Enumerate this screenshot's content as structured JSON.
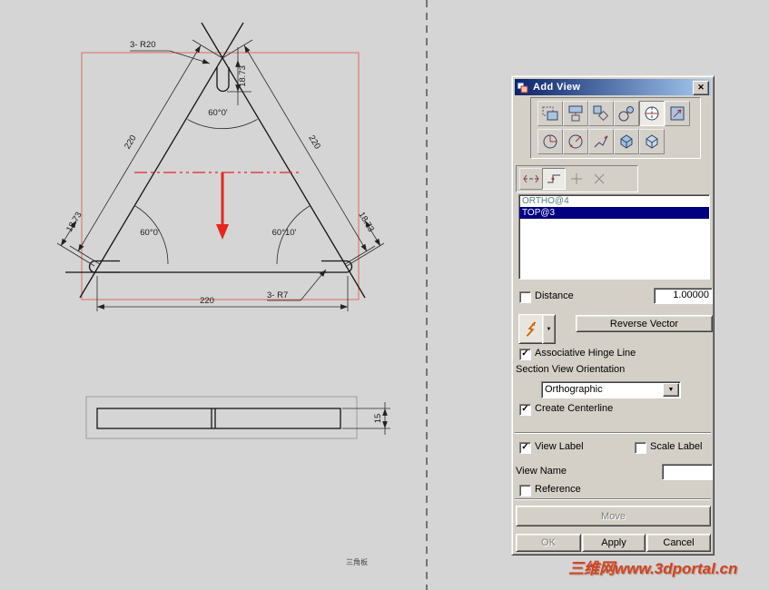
{
  "colors": {
    "selection_navy": "#000080",
    "section_arrow_red": "#e8251d",
    "view_boundary_red": "#dd6a5a",
    "watermark_orange": "#cd4621"
  },
  "icons": {
    "close": "✕",
    "dropdown": "▼",
    "check": "✓"
  },
  "drawing": {
    "radius_note_top": "3- R20",
    "slot_depth": "18.73",
    "angle_top": "60°0'",
    "side_left": "220",
    "side_right": "220",
    "notch_left": "18.73",
    "angle_bottom_left": "60°0'",
    "angle_bottom_right": "60°10'",
    "notch_right": "18.73",
    "side_bottom": "220",
    "radius_note_bottom": "3- R7",
    "thickness": "15",
    "title_block": "三角板"
  },
  "watermark": "三维网www.3dportal.cn",
  "dialog": {
    "title": "Add View",
    "view_list": [
      {
        "label": "ORTHO@4"
      },
      {
        "label": "TOP@3"
      }
    ],
    "distance_label": "Distance",
    "distance_value": "1.00000",
    "reverse_vector_label": "Reverse Vector",
    "associative_hinge_label": "Associative Hinge Line",
    "section_orientation_label": "Section View Orientation",
    "orientation_value": "Orthographic",
    "create_centerline_label": "Create Centerline",
    "view_label_label": "View Label",
    "scale_label_label": "Scale Label",
    "view_name_label": "View Name",
    "reference_label": "Reference",
    "move_label": "Move",
    "ok_label": "OK",
    "apply_label": "Apply",
    "cancel_label": "Cancel"
  }
}
